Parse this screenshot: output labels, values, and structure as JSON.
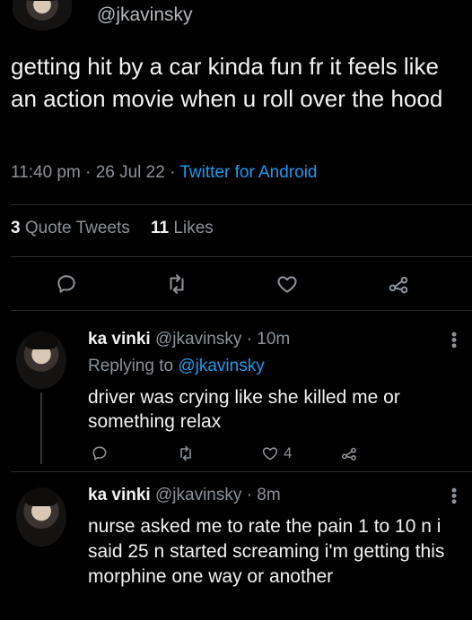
{
  "main_tweet": {
    "handle": "@jkavinsky",
    "text": "getting hit by a car kinda fun fr it feels like an action movie when u roll over the hood",
    "time": "11:40 pm",
    "date": "26 Jul 22",
    "client": "Twitter for Android",
    "sep": "·",
    "quote_count": "3",
    "quote_label": "Quote Tweets",
    "like_count": "11",
    "like_label": "Likes"
  },
  "replies": [
    {
      "name": "ka vinki",
      "handle": "@jkavinsky",
      "age": "10m",
      "sep": "·",
      "replying_label": "Replying to",
      "replying_to": "@jkavinsky",
      "text": "driver was crying like she killed me or something relax",
      "like_count": "4"
    },
    {
      "name": "ka vinki",
      "handle": "@jkavinsky",
      "age": "8m",
      "sep": "·",
      "text": "nurse asked me to rate the pain 1 to 10 n i said 25 n started screaming i'm getting this morphine one way or another"
    }
  ],
  "icons": {
    "reply": "comment-icon",
    "retweet": "retweet-icon",
    "like": "heart-icon",
    "share": "share-icon",
    "more": "more-icon"
  },
  "colors": {
    "background": "#000000",
    "text": "#e7e9ea",
    "secondary": "#8b9298",
    "accent": "#1d9bf0"
  }
}
